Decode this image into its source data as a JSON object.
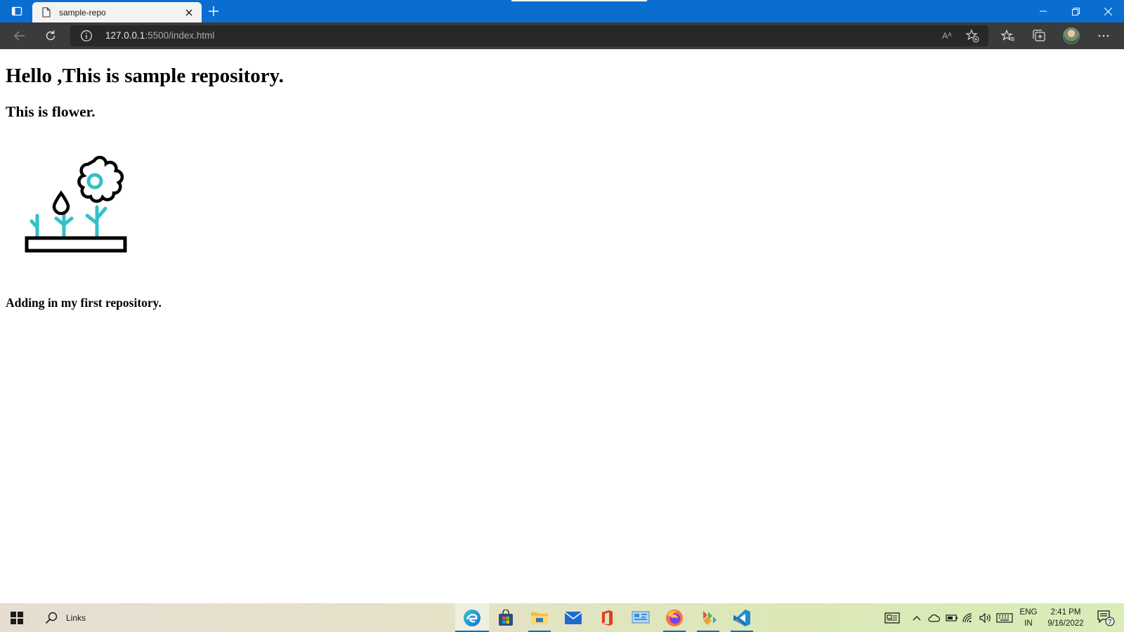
{
  "browser": {
    "tab": {
      "title": "sample-repo"
    },
    "address": {
      "host": "127.0.0.1",
      "path": ":5500/index.html"
    },
    "read_aloud_glyph": "Aᴬ",
    "colors": {
      "titlebar": "#0a6ed1",
      "toolbar": "#3b3b3b",
      "address_field": "#282828"
    }
  },
  "page": {
    "heading": "Hello ,This is sample repository.",
    "subheading": "This is flower.",
    "image_icon": "flower-illustration",
    "footer_text": "Adding in my first repository.",
    "colors": {
      "outline": "#000000",
      "accent": "#35c0c6"
    }
  },
  "taskbar": {
    "search_label": "Links",
    "apps": [
      "edge-icon",
      "store-icon",
      "file-explorer-icon",
      "mail-icon",
      "office-icon",
      "control-panel-icon",
      "firefox-icon",
      "git-icon",
      "vscode-icon"
    ],
    "tray": {
      "language_top": "ENG",
      "language_bottom": "IN",
      "time": "2:41 PM",
      "date": "9/16/2022",
      "notification_count": "7"
    }
  }
}
